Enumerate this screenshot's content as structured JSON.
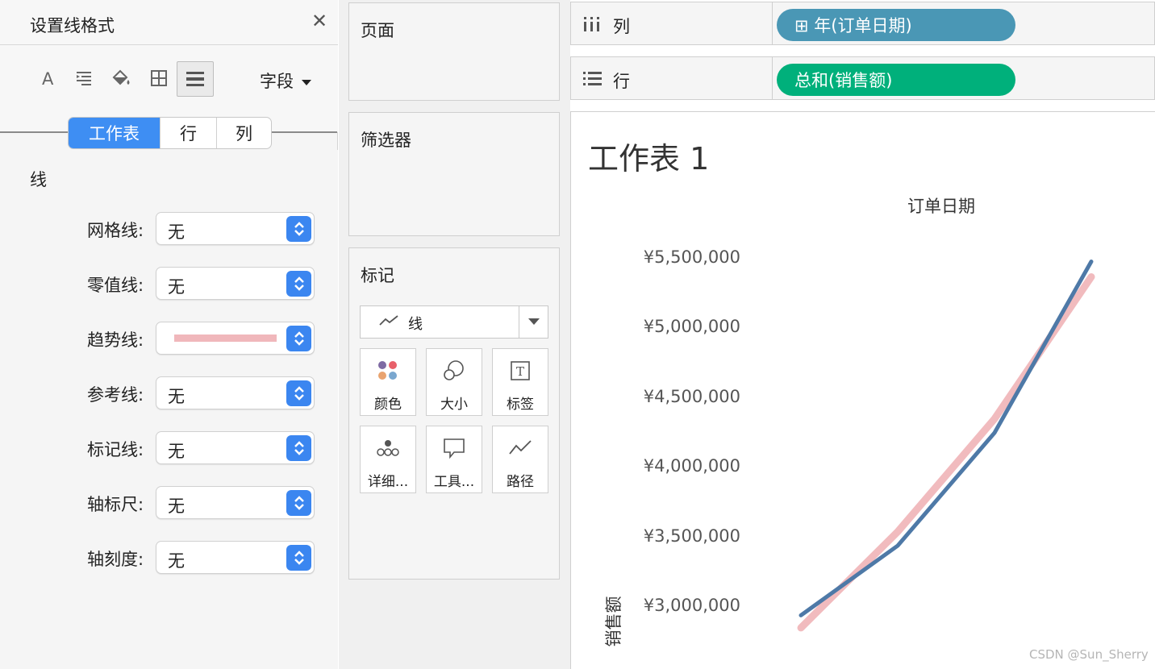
{
  "format_pane": {
    "title": "设置线格式",
    "field_menu": "字段",
    "scope_tabs": [
      "工作表",
      "行",
      "列"
    ],
    "section_title": "线",
    "rows": [
      {
        "label": "网格线:",
        "value": "无"
      },
      {
        "label": "零值线:",
        "value": "无"
      },
      {
        "label": "趋势线:",
        "value": ""
      },
      {
        "label": "参考线:",
        "value": "无"
      },
      {
        "label": "标记线:",
        "value": "无"
      },
      {
        "label": "轴标尺:",
        "value": "无"
      },
      {
        "label": "轴刻度:",
        "value": "无"
      }
    ],
    "trend_swatch_color": "#f0b7bb",
    "accent_color": "#3e8ef3"
  },
  "cards": {
    "pages": "页面",
    "filters": "筛选器",
    "marks": "标记"
  },
  "marks": {
    "type": "线",
    "buttons": [
      "颜色",
      "大小",
      "标签",
      "详细...",
      "工具...",
      "路径"
    ]
  },
  "shelves": {
    "columns_label": "列",
    "columns_pill": "⊞ 年(订单日期)",
    "columns_pill_color": "#4a97b5",
    "rows_label": "行",
    "rows_pill": "总和(销售额)",
    "rows_pill_color": "#00b07b"
  },
  "view": {
    "worksheet_title": "工作表 1",
    "x_header": "订单日期"
  },
  "chart_data": {
    "type": "line",
    "title": "工作表 1",
    "xlabel": "订单日期",
    "ylabel": "销售额",
    "y_ticks": [
      "¥3,000,000",
      "¥3,500,000",
      "¥4,000,000",
      "¥4,500,000",
      "¥5,000,000",
      "¥5,500,000"
    ],
    "ylim": [
      2800000,
      5550000
    ],
    "x": [
      1,
      2,
      3,
      4
    ],
    "series": [
      {
        "values": [
          2940000,
          3440000,
          4250000,
          5480000
        ],
        "color": "#4e79a7"
      },
      {
        "values": [
          2850000,
          3540000,
          4350000,
          5370000
        ],
        "color": "#f0b7bb"
      }
    ],
    "grid": false
  },
  "watermark": "CSDN @Sun_Sherry"
}
